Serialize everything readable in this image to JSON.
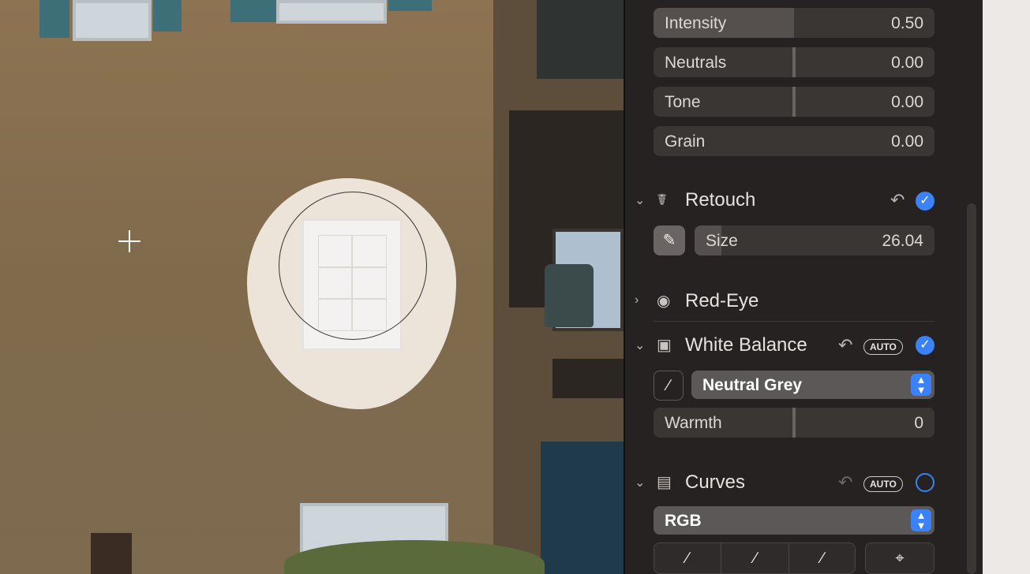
{
  "adjustments": {
    "intensity": {
      "label": "Intensity",
      "value": "0.50",
      "fill": 0.5
    },
    "neutrals": {
      "label": "Neutrals",
      "value": "0.00"
    },
    "tone": {
      "label": "Tone",
      "value": "0.00"
    },
    "grain": {
      "label": "Grain",
      "value": "0.00"
    }
  },
  "retouch": {
    "title": "Retouch",
    "size_label": "Size",
    "size_value": "26.04"
  },
  "redeye": {
    "title": "Red-Eye"
  },
  "white_balance": {
    "title": "White Balance",
    "auto_label": "AUTO",
    "mode": "Neutral Grey",
    "warmth_label": "Warmth",
    "warmth_value": "0"
  },
  "curves": {
    "title": "Curves",
    "auto_label": "AUTO",
    "channel": "RGB"
  },
  "colors": {
    "accent": "#3b82f6",
    "panel": "#252221"
  }
}
